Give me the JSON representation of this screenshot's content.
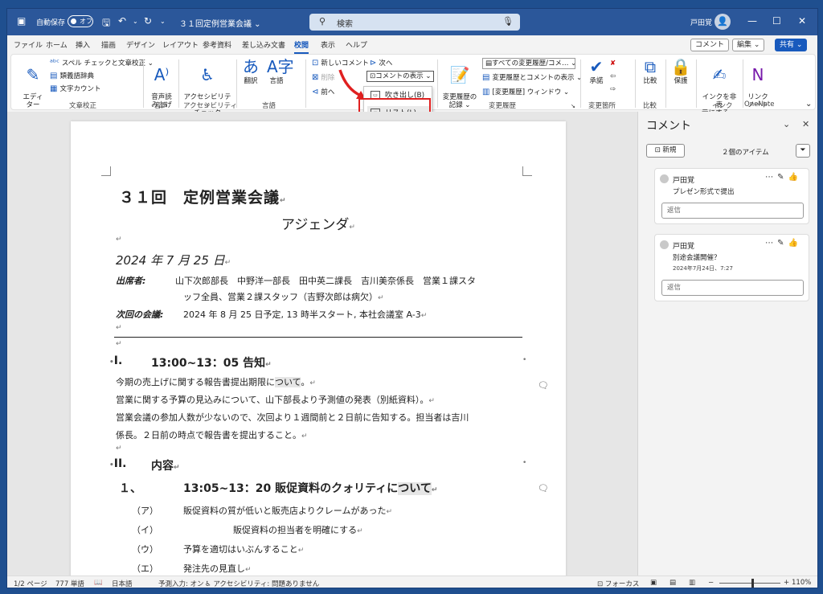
{
  "titlebar": {
    "autosave_label": "自動保存",
    "autosave_state": "オフ",
    "doc_title": "３１回定例営業会議 ⌄",
    "search_placeholder": "検索",
    "user_name": "戸田覚",
    "buttons": {
      "minimize": "—",
      "maximize": "☐",
      "close": "✕"
    }
  },
  "menubar": {
    "tabs": [
      "ファイル",
      "ホーム",
      "挿入",
      "描画",
      "デザイン",
      "レイアウト",
      "参考資料",
      "差し込み文書",
      "校閲",
      "表示",
      "ヘルプ"
    ],
    "active_tab": "校閲",
    "comment_btn": "コメント",
    "edit_btn": "編集 ⌄",
    "share_btn": "共有 ⌄"
  },
  "ribbon": {
    "proofing": {
      "editor": "エディ\nター",
      "spell": "スペル チェックと文章校正",
      "thesaurus": "類義語辞典",
      "wordcount": "文字カウント",
      "group": "文章校正"
    },
    "speech": {
      "readaloud": "音声読\nみ上げ",
      "group": "音声"
    },
    "accessibility": {
      "check": "アクセシビリティ\nチェック",
      "group": "アクセシビリティ"
    },
    "language": {
      "translate": "翻訳",
      "language": "言語",
      "group": "言語"
    },
    "comments": {
      "new": "新しいコメント",
      "delete": "削除",
      "prev": "前へ",
      "next": "次へ",
      "show": "コメントの表示 ⌄",
      "group": "コメント"
    },
    "tracking": {
      "record": "変更履歴の\n記録 ⌄",
      "markup_select": "すべての変更履歴/コメ… ⌄",
      "show_markup": "変更履歴とコメントの表示 ⌄",
      "pane": "[変更履歴] ウィンドウ ⌄",
      "group": "変更履歴"
    },
    "changes": {
      "accept": "承諾",
      "group": "変更箇所"
    },
    "compare": {
      "compare": "比較",
      "group": "比較"
    },
    "protect": {
      "protect": "保護"
    },
    "ink": {
      "hide": "インクを非表\n示にする ⌄",
      "group": "インク"
    },
    "onenote": {
      "link": "リンク\nノート",
      "group": "OneNote"
    }
  },
  "dropdown": {
    "items": [
      {
        "label": "吹き出し(B)"
      },
      {
        "label": "リスト(L)"
      }
    ]
  },
  "document": {
    "title": "３１回　定例営業会議",
    "subtitle": "アジェンダ",
    "date": "2024 年 7 月 25 日",
    "attendees_label": "出席者:",
    "attendees_line1": "山下次郎部長　中野洋一部長　田中英二課長　吉川美奈係長　営業１課スタ",
    "attendees_line2": "ッフ全員、営業２課スタッフ（吉野次郎は病欠）",
    "next_label": "次回の会議:",
    "next_value": "2024 年 8 月 25 日予定, 13 時半スタート, 本社会議室 A-3",
    "sec1_num": "I.",
    "sec1_title": "13:00~13：05 告知",
    "p1_a": "今期の売上げに関する報告書提出期限に",
    "p1_hl": "ついて",
    "p1_b": "。",
    "p2": "営業に関する予算の見込みについて、山下部長より予測値の発表（別紙資料）。",
    "p3a": "営業会議の参加人数が少ないので、次回より１週間前と２日前に告知する。担当者は吉川",
    "p3b": "係長。２日前の時点で報告書を提出すること。",
    "sec2_num": "II.",
    "sec2_title": "内容",
    "sub1_num": "１、",
    "sub1_title_a": "13:05~13：20 販促資料のクォリティに",
    "sub1_title_hl": "ついて",
    "items": [
      {
        "num": "（ア）",
        "text": "販促資料の質が低いと販売店よりクレームがあった"
      },
      {
        "num": "（イ）",
        "text": "販促資料の担当者を明確にする"
      },
      {
        "num": "（ウ）",
        "text": "予算を適切はいぶんすること"
      },
      {
        "num": "（エ）",
        "text": "発注先の見直し"
      }
    ]
  },
  "comments_pane": {
    "title": "コメント",
    "new_btn": "新規",
    "count": "２個のアイテム",
    "cards": [
      {
        "author": "戸田覚",
        "body": "プレゼン形式で提出",
        "timestamp": "",
        "reply_placeholder": "返信"
      },
      {
        "author": "戸田覚",
        "body": "別途会議開催？",
        "timestamp": "2024年7月24日、7:27",
        "reply_placeholder": "返信"
      }
    ]
  },
  "statusbar": {
    "page": "1/2 ページ",
    "words": "777 単語",
    "language": "日本語",
    "predict": "予測入力: オン",
    "accessibility": "アクセシビリティ: 問題ありません",
    "focus": "フォーカス",
    "zoom": "110%",
    "zoom_fraction": 0.55
  }
}
